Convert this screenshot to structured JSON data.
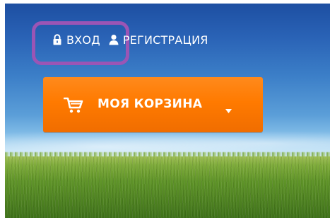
{
  "header": {
    "login_label": "ВХОД",
    "register_label": "РЕГИСТРАЦИЯ",
    "login_icon": "lock-icon",
    "register_icon": "user-icon"
  },
  "cart": {
    "label": "МОЯ КОРЗИНА",
    "icon": "shopping-cart-icon",
    "dropdown_icon": "chevron-down-icon"
  },
  "colors": {
    "cart_button": "#ff7a00",
    "highlight": "#9b55b5",
    "sky_top": "#1d4fa2",
    "grass": "#5f9428",
    "text": "#ffffff"
  }
}
